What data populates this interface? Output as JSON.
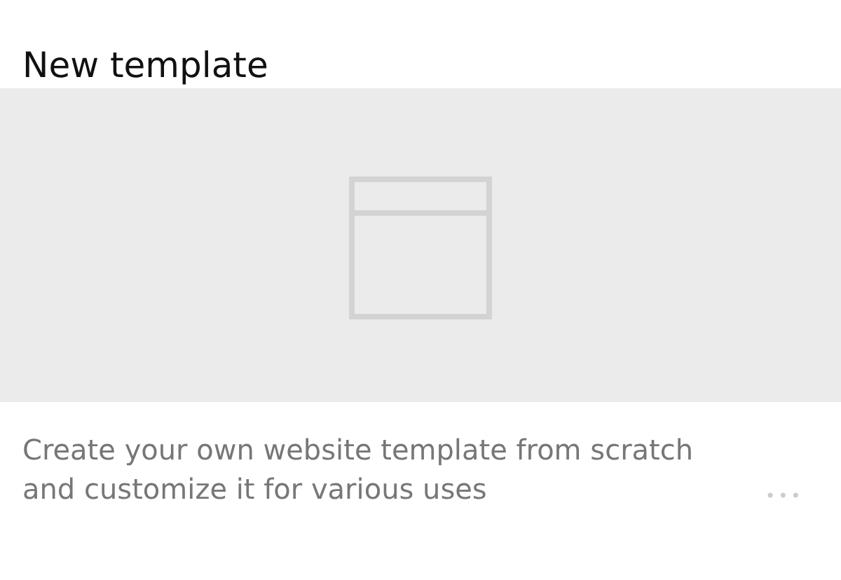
{
  "card": {
    "title": "New template",
    "description": "Create your own website template from scratch and customize it for various uses",
    "more_button": "•••"
  }
}
